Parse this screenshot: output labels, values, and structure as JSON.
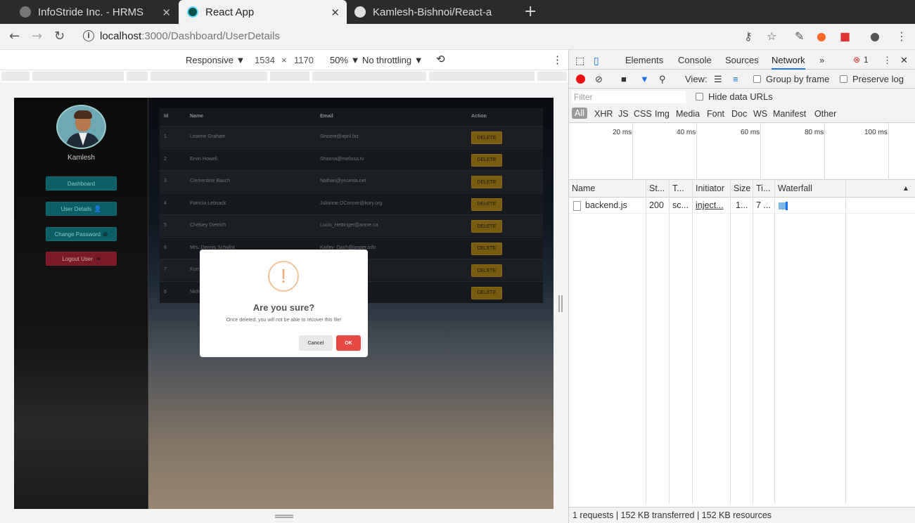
{
  "tabs": [
    {
      "title": "InfoStride Inc. - HRMS",
      "close": "✕"
    },
    {
      "title": "React App",
      "close": "✕"
    },
    {
      "title": "Kamlesh-Bishnoi/React-a",
      "close": "✕"
    }
  ],
  "new_tab": "+",
  "address": {
    "host": "localhost",
    "path": ":3000/Dashboard/UserDetails"
  },
  "device_toolbar": {
    "mode": "Responsive ▼",
    "width": "1534",
    "times": "×",
    "height": "1170",
    "zoom": "50% ▼",
    "throttle": "No throttling ▼"
  },
  "sidebar": {
    "username": "Kamlesh",
    "buttons": [
      {
        "label": "Dashboard"
      },
      {
        "label": "User Details"
      },
      {
        "label": "Change Password"
      },
      {
        "label": "Logout User"
      }
    ]
  },
  "table": {
    "headers": {
      "id": "Id",
      "name": "Name",
      "email": "Email",
      "action": "Action"
    },
    "delete_label": "DELETE",
    "rows": [
      {
        "id": "1",
        "name": "Leanne Graham",
        "email": "Sincere@april.biz"
      },
      {
        "id": "2",
        "name": "Ervin Howell",
        "email": "Shanna@melissa.tv"
      },
      {
        "id": "3",
        "name": "Clementine Bauch",
        "email": "Nathan@yesenia.net"
      },
      {
        "id": "4",
        "name": "Patricia Lebsack",
        "email": "Julianne.OConner@kory.org"
      },
      {
        "id": "5",
        "name": "Chelsey Dietrich",
        "email": "Lucio_Hettinger@annie.ca"
      },
      {
        "id": "6",
        "name": "Mrs. Dennis Schulist",
        "email": "Karley_Dach@jasper.info"
      },
      {
        "id": "7",
        "name": "Kurt",
        "email": "biz"
      },
      {
        "id": "8",
        "name": "Nich",
        "email": "ond.me"
      }
    ]
  },
  "modal": {
    "icon": "!",
    "title": "Are you sure?",
    "text": "Once deleted, you will not be able to recover this file!",
    "cancel": "Cancel",
    "ok": "OK"
  },
  "devtools": {
    "tabs": [
      "Elements",
      "Console",
      "Sources",
      "Network"
    ],
    "more": "»",
    "error_count": "1",
    "view_label": "View:",
    "group_by_frame": "Group by frame",
    "preserve_log": "Preserve log",
    "filter_placeholder": "Filter",
    "hide_data_urls": "Hide data URLs",
    "types": [
      "All",
      "XHR",
      "JS",
      "CSS",
      "Img",
      "Media",
      "Font",
      "Doc",
      "WS",
      "Manifest",
      "Other"
    ],
    "timeline_ticks": [
      "20 ms",
      "40 ms",
      "60 ms",
      "80 ms",
      "100 ms"
    ],
    "columns": {
      "name": "Name",
      "status": "St...",
      "type": "T...",
      "initiator": "Initiator",
      "size": "Size",
      "time": "Ti...",
      "waterfall": "Waterfall"
    },
    "request": {
      "name": "backend.js",
      "status": "200",
      "type": "sc...",
      "initiator": "inject...",
      "size": "1...",
      "time": "7 ..."
    },
    "summary": "1 requests  |  152 KB transferred  |  152 KB resources"
  }
}
